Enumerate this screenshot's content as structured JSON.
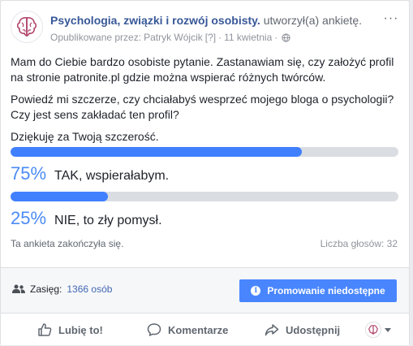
{
  "post": {
    "page_name": "Psychologia, związki i rozwój osobisty.",
    "action_text": "utworzył(a) ankietę.",
    "published_label": "Opublikowane przez:",
    "author": "Patryk Wójcik",
    "author_tag": "[?]",
    "separator": "·",
    "date": "11 kwietnia",
    "more_label": "···",
    "paragraphs": [
      "Mam do Ciebie bardzo osobiste pytanie. Zastanawiam się, czy założyć profil na stronie patronite.pl gdzie można wspierać różnych twórców.",
      "Powiedź mi szczerze, czy chciałabyś wesprzeć mojego bloga o psychologii? Czy jest sens zakładać ten profil?",
      "Dziękuję za Twoją szczerość."
    ]
  },
  "poll": {
    "options": [
      {
        "percent_label": "75%",
        "label": "TAK, wspierałabym.",
        "fraction": 0.75
      },
      {
        "percent_label": "25%",
        "label": "NIE, to zły pomysł.",
        "fraction": 0.25
      }
    ],
    "ended_text": "Ta ankieta zakończyła się.",
    "votes_text": "Liczba głosów: 32"
  },
  "reach": {
    "label": "Zasięg:",
    "value": "1366 osób",
    "promote_label": "Promowanie niedostępne",
    "promote_icon": "i"
  },
  "actions": {
    "like": "Lubię to!",
    "comment": "Komentarze",
    "share": "Udostępnij"
  },
  "colors": {
    "accent": "#4080ff",
    "link": "#385898",
    "poll_percent": "#4b8bf5"
  }
}
